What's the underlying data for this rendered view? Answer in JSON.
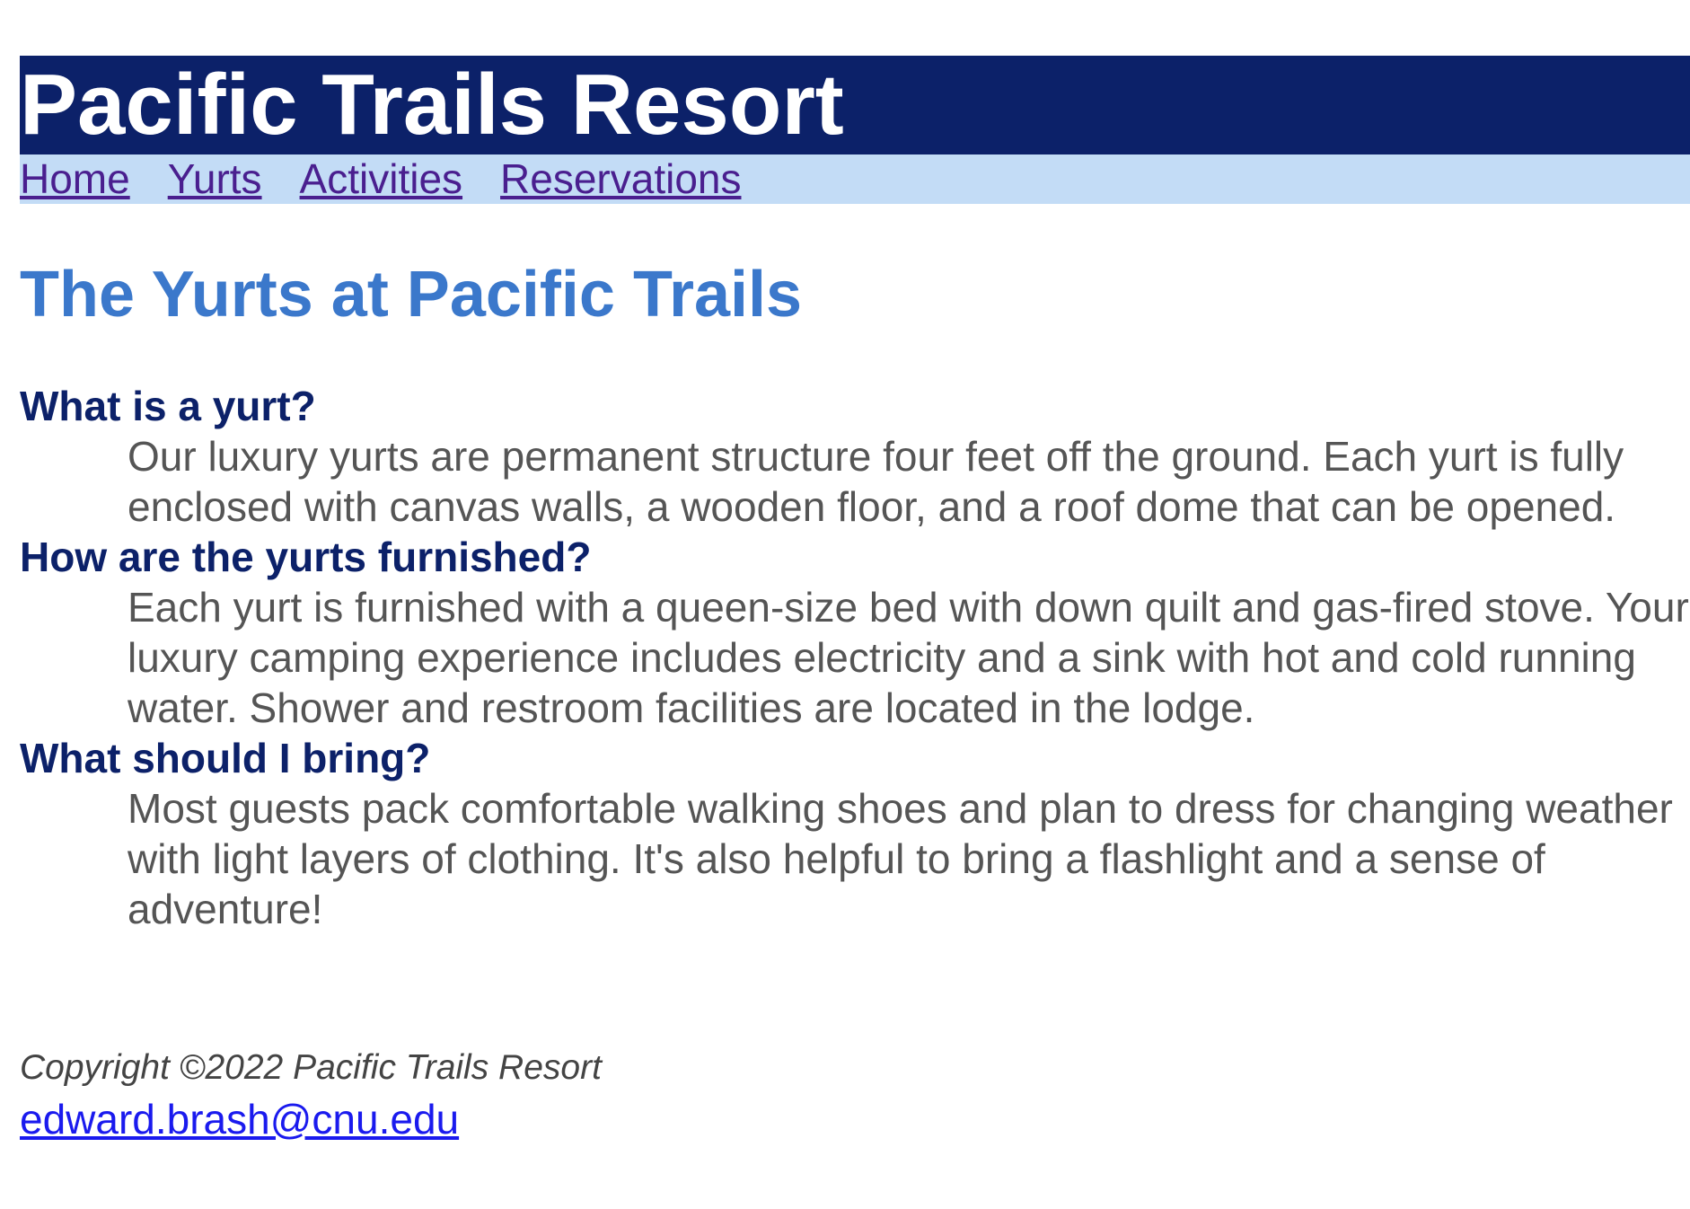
{
  "header": {
    "site_title": "Pacific Trails Resort"
  },
  "nav": {
    "items": [
      {
        "label": "Home"
      },
      {
        "label": "Yurts"
      },
      {
        "label": "Activities"
      },
      {
        "label": "Reservations"
      }
    ]
  },
  "main": {
    "heading": "The Yurts at Pacific Trails",
    "faq": [
      {
        "question": "What is a yurt?",
        "answer": "Our luxury yurts are permanent structure four feet off the ground. Each yurt is fully enclosed with canvas walls, a wooden floor, and a roof dome that can be opened."
      },
      {
        "question": "How are the yurts furnished?",
        "answer": "Each yurt is furnished with a queen-size bed with down quilt and gas-fired stove. Your luxury camping experience includes electricity and a sink with hot and cold running water. Shower and restroom facilities are located in the lodge."
      },
      {
        "question": "What should I bring?",
        "answer": "Most guests pack comfortable walking shoes and plan to dress for changing weather with light layers of clothing. It's also helpful to bring a flashlight and a sense of adventure!"
      }
    ]
  },
  "footer": {
    "copyright": "Copyright ©2022 Pacific Trails Resort",
    "email": "edward.brash@cnu.edu"
  },
  "colors": {
    "header_bg": "#0c2169",
    "nav_bg": "#c3dcf6",
    "heading": "#3b78cb",
    "question": "#0c2169",
    "answer_text": "#555555",
    "visited_link": "#4a1f8f",
    "link": "#1a1aee"
  }
}
